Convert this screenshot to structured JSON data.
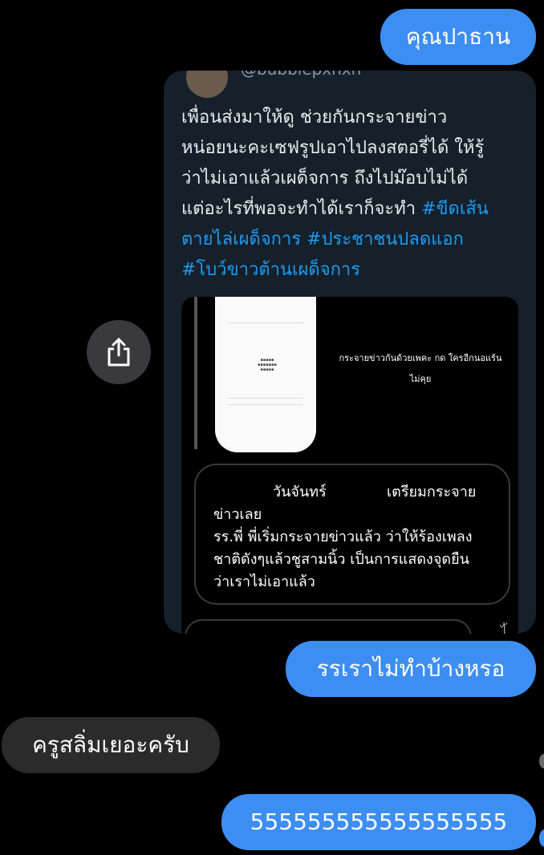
{
  "messages": [
    {
      "id": "b1",
      "text": "คุณปาธาน",
      "direction": "outgoing"
    },
    {
      "id": "b3",
      "text": "รรเราไม่ทำบ้างหรอ",
      "direction": "outgoing"
    },
    {
      "id": "b4",
      "text": "ครูสลิ่มเยอะครับ",
      "direction": "incoming"
    },
    {
      "id": "b5",
      "text": "555555555555555555",
      "direction": "outgoing"
    }
  ],
  "shared_post": {
    "handle": "@bubblepxnxn",
    "text_plain": "เพื่อนส่งมาให้ดู ช่วยกันกระจายข่าว\nหน่อยนะคะเซฟรูปเอาไปลงสตอรี่ได้ ให้รู้\nว่าไม่เอาแล้วเผด็จการ ถึงไปม๊อบไม่ได้\nแต่อะไรที่พอจะทำได้เราก็จะทำ ",
    "hashtags_line1": "#ขีดเส้น",
    "hashtags_rest": "ตายไล่เผด็จการ #ประชาชนปลดแอก\n#โบว์ขาวต้านเผด็จการ",
    "media": {
      "caption": "กระจายข่าวกันด้วยเพคะ กด ใครอีกนอแร้น\nไม่คุย",
      "note_day": "วันจันทร์",
      "note_heading": "เตรียมกระจาย",
      "note_body": "ข่าวเลย\nรร.พี่ พี่เริ่มกระจายข่าวแล้ว ว่าให้ร้องเพลง\nชาติดังๆแล้วชูสามนิ้ว เป็นการแสดงจุดยืน\nว่าเราไม่เอาแล้ว",
      "side_tail": "ไ้"
    }
  },
  "share_button": {
    "icon": "share-icon"
  },
  "colors": {
    "outgoing": "#3d8ef2",
    "incoming": "#2b2b2c",
    "background": "#000000",
    "card": "#15202b",
    "hashtag": "#1d9bf0"
  }
}
